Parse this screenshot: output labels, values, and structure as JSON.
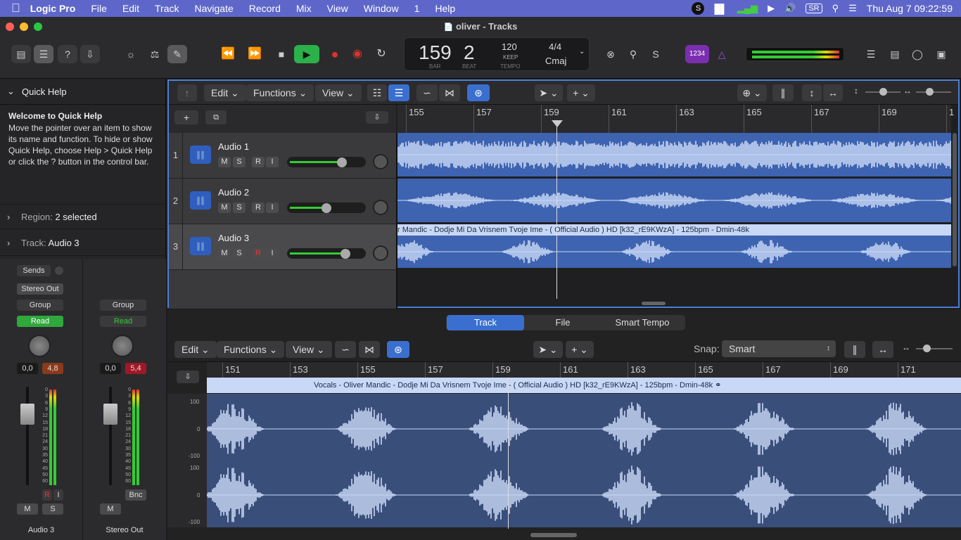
{
  "menubar": {
    "app": "Logic Pro",
    "items": [
      "File",
      "Edit",
      "Track",
      "Navigate",
      "Record",
      "Mix",
      "View",
      "Window",
      "1",
      "Help"
    ],
    "sr_badge": "SR",
    "datetime": "Thu Aug 7  09:22:59"
  },
  "window": {
    "title": "oliver - Tracks"
  },
  "lcd": {
    "bar": "159",
    "beat": "2",
    "bar_label": "BAR",
    "beat_label": "BEAT",
    "tempo": "120",
    "tempo_mode": "KEEP",
    "tempo_label": "TEMPO",
    "signature": "4/4",
    "key": "Cmaj"
  },
  "count_in_badge": "1234",
  "quickhelp": {
    "title": "Quick Help",
    "heading": "Welcome to Quick Help",
    "body": "Move the pointer over an item to show its name and function. To hide or show Quick Help, choose Help > Quick Help or click the ? button in the control bar."
  },
  "inspector": {
    "region_label": "Region:",
    "region_value": "2 selected",
    "track_label": "Track:",
    "track_value": "Audio 3",
    "sends": "Sends",
    "left_strip": {
      "output": "Stereo Out",
      "group": "Group",
      "automation": "Read",
      "value1": "0,0",
      "value2": "4,8",
      "mute": "M",
      "solo": "S",
      "rec": "R",
      "input": "I",
      "name": "Audio 3"
    },
    "right_strip": {
      "group": "Group",
      "automation": "Read",
      "value1": "0,0",
      "value2": "5,4",
      "mute": "M",
      "bounce": "Bnc",
      "name": "Stereo Out"
    },
    "meter_scale": [
      "0",
      "3",
      "6",
      "9",
      "12",
      "15",
      "18",
      "21",
      "24",
      "30",
      "35",
      "40",
      "45",
      "50",
      "60"
    ]
  },
  "tracks_toolbar": {
    "edit": "Edit",
    "functions": "Functions",
    "view": "View"
  },
  "tracks_ruler": [
    "155",
    "157",
    "159",
    "161",
    "163",
    "165",
    "167",
    "169",
    "1"
  ],
  "tracks": [
    {
      "num": "1",
      "name": "Audio 1",
      "m": "M",
      "s": "S",
      "r": "R",
      "i": "I",
      "volume": 0.78
    },
    {
      "num": "2",
      "name": "Audio 2",
      "m": "M",
      "s": "S",
      "r": "R",
      "i": "I",
      "volume": 0.55
    },
    {
      "num": "3",
      "name": "Audio 3",
      "m": "M",
      "s": "S",
      "r": "R",
      "i": "I",
      "volume": 0.83
    }
  ],
  "region3_title": "r Mandic -  Dodje Mi Da Vrisnem Tvoje Ime - ( Official Audio ) HD [k32_rE9KWzA] - 125bpm - Dmin-48k",
  "editor": {
    "tabs": [
      "Track",
      "File",
      "Smart Tempo"
    ],
    "edit": "Edit",
    "functions": "Functions",
    "view": "View",
    "snap_label": "Snap:",
    "snap_value": "Smart",
    "ruler": [
      "151",
      "153",
      "155",
      "157",
      "159",
      "161",
      "163",
      "165",
      "167",
      "169",
      "171"
    ],
    "region_title": "Vocals - Oliver Mandic -  Dodje Mi Da Vrisnem Tvoje Ime - ( Official Audio ) HD [k32_rE9KWzA] - 125bpm - Dmin-48k",
    "amp_scale": [
      "100",
      "0",
      "-100",
      "100",
      "0",
      "-100"
    ]
  },
  "colors": {
    "menubar": "#5e67c9",
    "region": "#3e63b0",
    "waveform": "#c8d8f6",
    "accent": "#3a6fd0",
    "play": "#2bb04a",
    "record": "#e0322c",
    "read": "#2fa83c"
  }
}
